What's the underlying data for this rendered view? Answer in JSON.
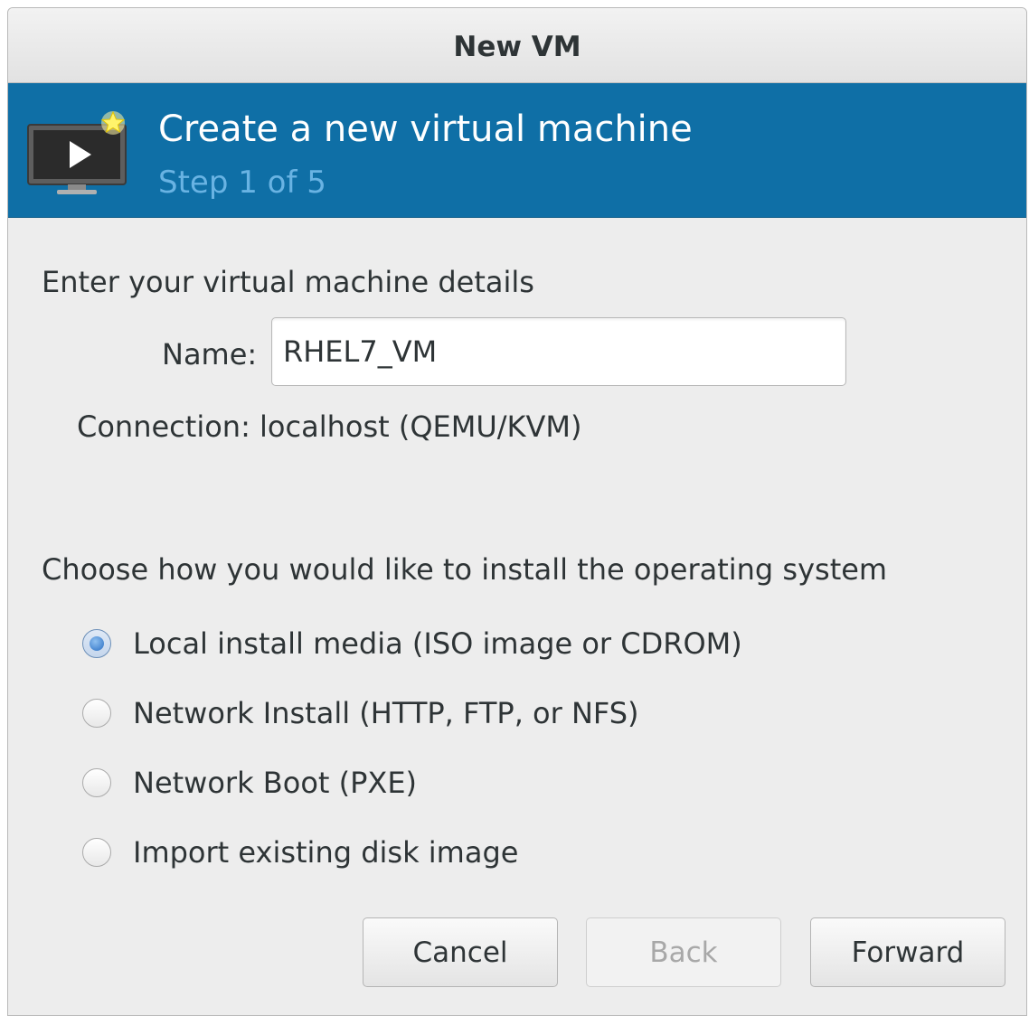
{
  "window": {
    "title": "New VM"
  },
  "banner": {
    "headline": "Create a new virtual machine",
    "step": "Step 1 of 5",
    "icon": "vm-monitor-icon"
  },
  "details": {
    "section_label": "Enter your virtual machine details",
    "name_label": "Name:",
    "name_value": "RHEL7_VM",
    "connection_label": "Connection:",
    "connection_value": "localhost (QEMU/KVM)"
  },
  "install": {
    "section_label": "Choose how you would like to install the operating system",
    "options": [
      {
        "label": "Local install media (ISO image or CDROM)",
        "selected": true
      },
      {
        "label": "Network Install (HTTP, FTP, or NFS)",
        "selected": false
      },
      {
        "label": "Network Boot (PXE)",
        "selected": false
      },
      {
        "label": "Import existing disk image",
        "selected": false
      }
    ]
  },
  "buttons": {
    "cancel": "Cancel",
    "back": "Back",
    "forward": "Forward"
  },
  "colors": {
    "banner_bg": "#0f6fa6",
    "step_text": "#69b3e3",
    "window_bg": "#ededed"
  }
}
